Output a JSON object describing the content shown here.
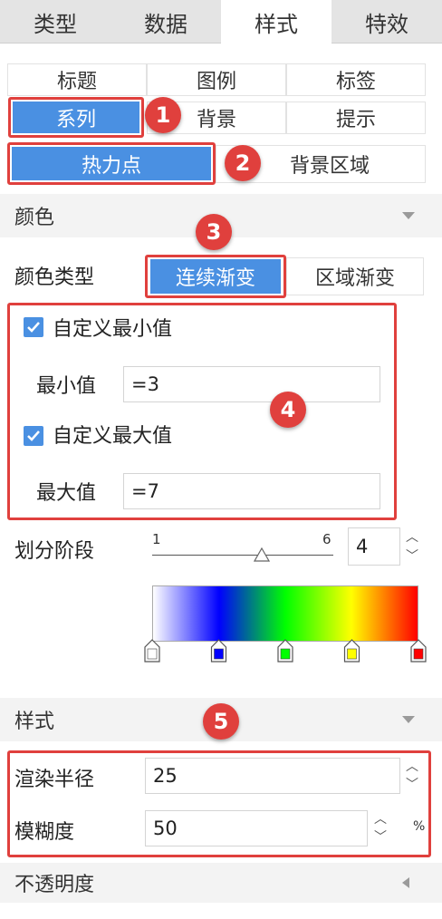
{
  "top_tabs": [
    "类型",
    "数据",
    "样式",
    "特效"
  ],
  "sub_tabs": {
    "title": "标题",
    "legend": "图例",
    "tag": "标签",
    "series": "系列",
    "background": "背景",
    "tooltip": "提示"
  },
  "series_tabs": {
    "heatpoint": "热力点",
    "bg_area": "背景区域"
  },
  "badges": [
    "1",
    "2",
    "3",
    "4",
    "5"
  ],
  "color_section": {
    "title": "颜色",
    "type_label": "颜色类型",
    "type_options": [
      "连续渐变",
      "区域渐变"
    ],
    "custom_min_label": "自定义最小值",
    "min_label": "最小值",
    "min_value": "=3",
    "custom_max_label": "自定义最大值",
    "max_label": "最大值",
    "max_value": "=7",
    "stages_label": "划分阶段",
    "slider_min": "1",
    "slider_max": "6",
    "stages_value": "4",
    "gradient_stops": [
      "#ffffff",
      "#0000ff",
      "#00ff00",
      "#ffff00",
      "#ff0000"
    ]
  },
  "style_section": {
    "title": "样式",
    "radius_label": "渲染半径",
    "radius_value": "25",
    "blur_label": "模糊度",
    "blur_value": "50",
    "blur_unit": "%"
  },
  "opacity_section": {
    "title": "不透明度"
  },
  "colors": {
    "accent": "#4a90e2",
    "highlight": "#e0403d"
  }
}
